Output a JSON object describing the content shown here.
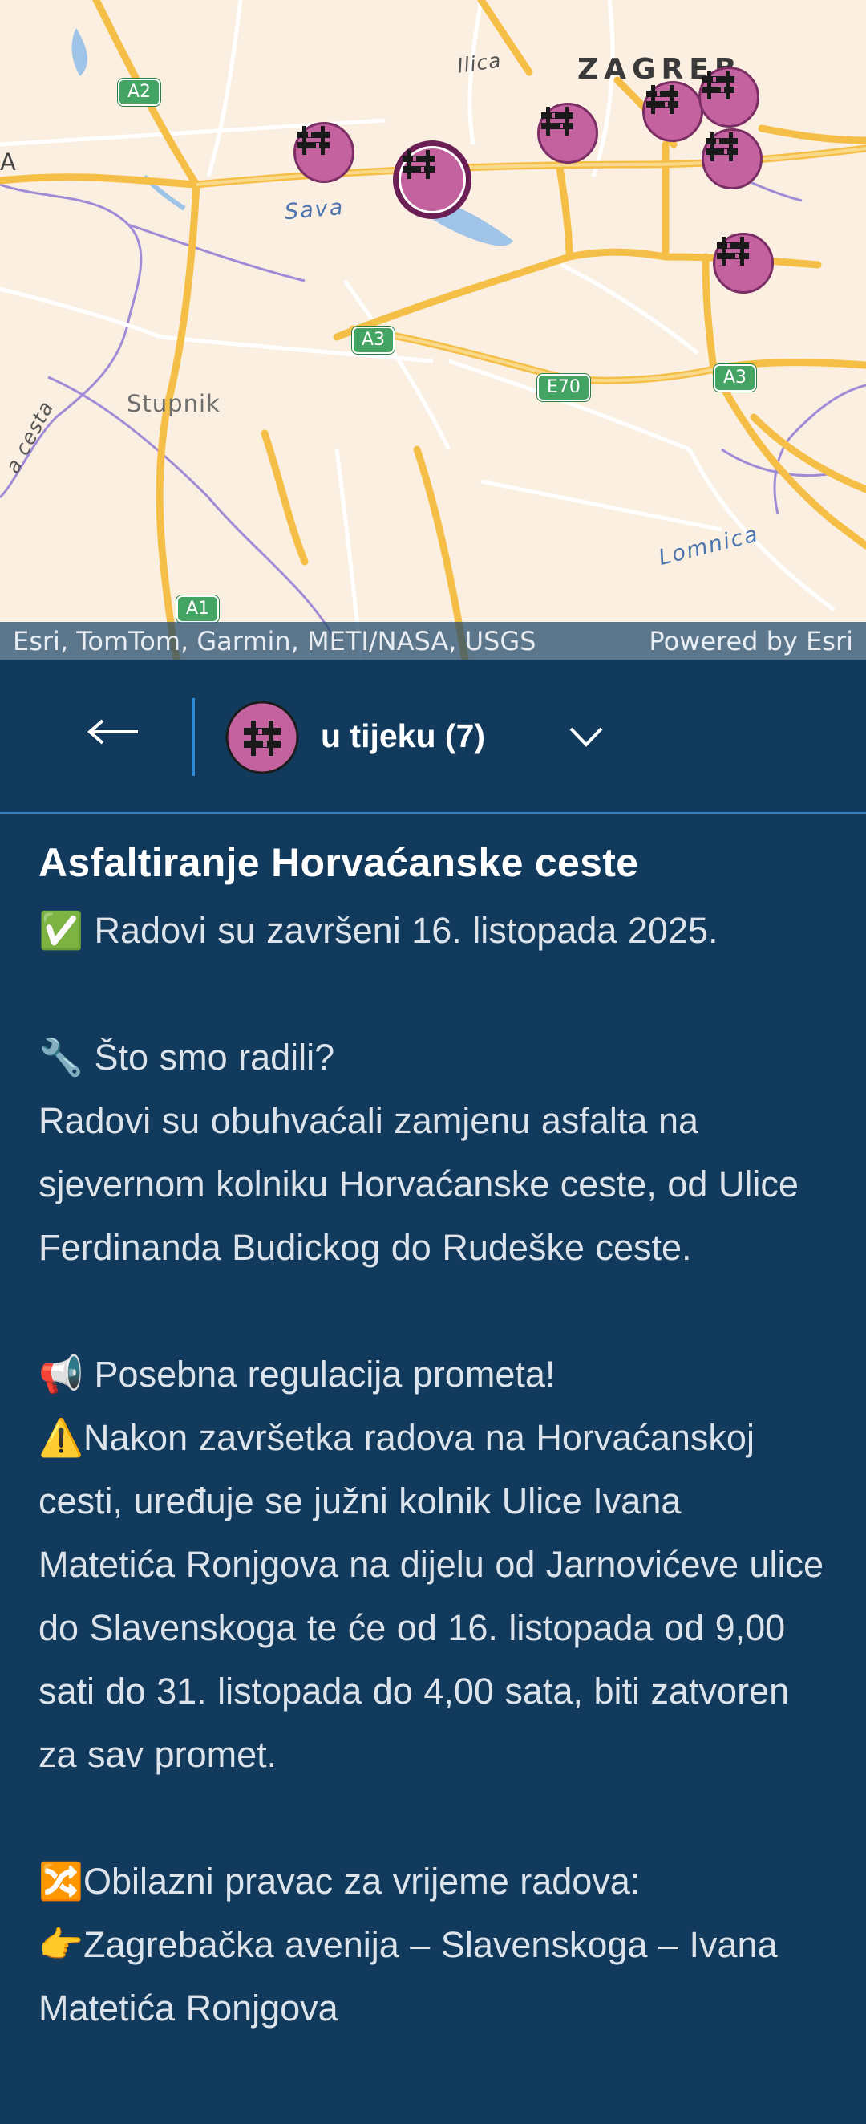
{
  "map": {
    "labels": {
      "city": "ZAGREB",
      "street_ilica": "Ilica",
      "river_sava": "Sava",
      "place_stupnik": "Stupnik",
      "street_left": "a cesta",
      "river_lomnica": "Lomnica",
      "edge_letter": "A"
    },
    "road_shields": {
      "a2": "A2",
      "a3_left": "A3",
      "e70": "E70",
      "a3_right": "A3",
      "a1": "A1"
    },
    "marker_icon": "roadworks-barrier-icon",
    "marker_color": "#c4619f",
    "attribution": "Esri, TomTom, Garmin, METI/NASA, USGS",
    "powered_by": "Powered by Esri"
  },
  "nav": {
    "back_icon": "arrow-left-icon",
    "status_icon": "roadworks-barrier-icon",
    "status_label": "u tijeku (7)",
    "dropdown_icon": "chevron-down-icon"
  },
  "article": {
    "title": "Asfaltiranje Horvaćanske ceste",
    "body": "✅ Radovi su završeni 16. listopada 2025.\n\n🔧 Što smo radili?\nRadovi su obuhvaćali zamjenu asfalta na sjevernom kolniku Horvaćanske ceste, od Ulice Ferdinanda Budickog do Rudeške ceste.\n\n📢 Posebna regulacija prometa!\n⚠️Nakon završetka radova na Horvaćanskoj cesti, uređuje se južni kolnik Ulice Ivana Matetića Ronjgova na dijelu od Jarnovićeve ulice do Slavenskoga te će od 16. listopada od 9,00 sati do 31. listopada do 4,00 sata, biti zatvoren za sav promet.\n\n🔀Obilazni pravac za vrijeme radova:\n👉Zagrebačka avenija – Slavenskoga – Ivana Matetića Ronjgova"
  },
  "colors": {
    "panel_bg": "#123a5c",
    "accent": "#2f8ad6",
    "marker": "#c4619f"
  }
}
